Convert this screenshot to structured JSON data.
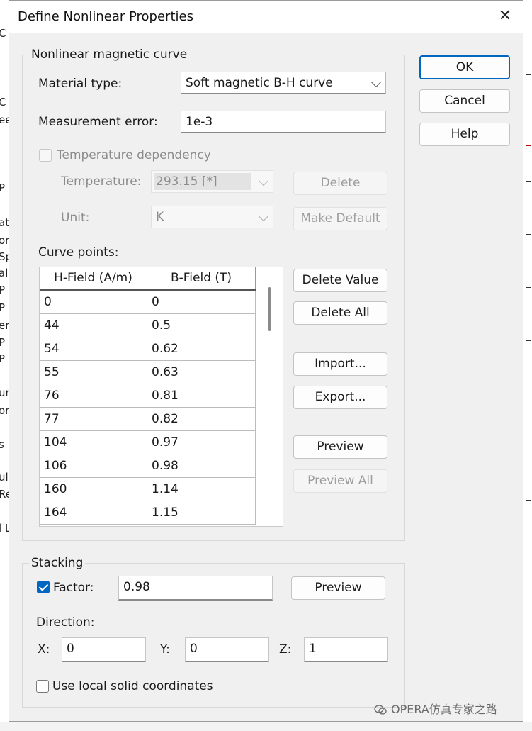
{
  "window": {
    "title": "Define Nonlinear Properties",
    "close_glyph": "✕"
  },
  "nonlinear": {
    "group_label": "Nonlinear magnetic curve",
    "material_type_label": "Material type:",
    "material_type_value": "Soft magnetic B-H curve",
    "measurement_error_label": "Measurement error:",
    "measurement_error_value": "1e-3",
    "temperature_dependency_label": "Temperature dependency",
    "temperature_dependency_checked": false,
    "temperature_label": "Temperature:",
    "temperature_value": "293.15 [*]",
    "unit_label": "Unit:",
    "unit_value": "K",
    "delete_label": "Delete",
    "make_default_label": "Make Default",
    "curve_points_label": "Curve points:",
    "columns": [
      "H-Field (A/m)",
      "B-Field (T)"
    ],
    "rows": [
      [
        "0",
        "0"
      ],
      [
        "44",
        "0.5"
      ],
      [
        "54",
        "0.62"
      ],
      [
        "55",
        "0.63"
      ],
      [
        "76",
        "0.81"
      ],
      [
        "77",
        "0.82"
      ],
      [
        "104",
        "0.97"
      ],
      [
        "106",
        "0.98"
      ],
      [
        "160",
        "1.14"
      ],
      [
        "164",
        "1.15"
      ]
    ],
    "delete_value_label": "Delete Value",
    "delete_all_label": "Delete All",
    "import_label": "Import...",
    "export_label": "Export...",
    "preview_label": "Preview",
    "preview_all_label": "Preview All"
  },
  "buttons": {
    "ok": "OK",
    "cancel": "Cancel",
    "help": "Help"
  },
  "stacking": {
    "group_label": "Stacking",
    "factor_label": "Factor:",
    "factor_checked": true,
    "factor_value": "0.98",
    "preview_label": "Preview",
    "direction_label": "Direction:",
    "x_label": "X:",
    "x_value": "0",
    "y_label": "Y:",
    "y_value": "0",
    "z_label": "Z:",
    "z_value": "1",
    "local_coords_label": "Use local solid coordinates",
    "local_coords_checked": false
  },
  "watermark": "OPERA仿真专家之路",
  "background_fragments": [
    "C",
    "ee",
    "P",
    "at",
    "or",
    "Sp",
    "als",
    "P",
    "P",
    "er",
    "P",
    "P",
    "ur",
    "or",
    "s",
    "ult",
    "Re",
    "l L"
  ],
  "colors": {
    "accent": "#0067c0",
    "dialog_bg": "#f0f0f0"
  }
}
